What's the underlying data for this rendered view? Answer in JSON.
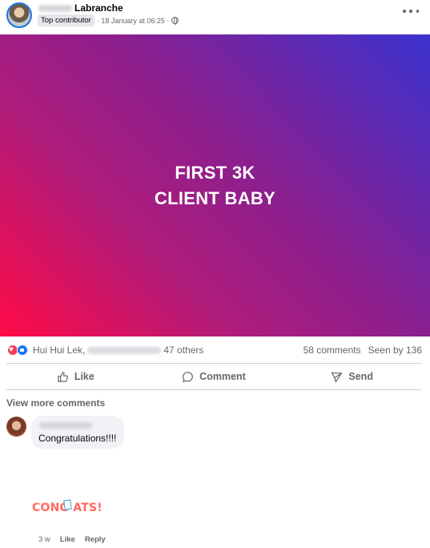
{
  "post": {
    "author_last_name": "Labranche",
    "badge": "Top contributor",
    "timestamp": "· 18 January at 06:25 ·",
    "banner_lines": [
      "FIRST 3K",
      "CLIENT BABY"
    ],
    "reactions": {
      "first_name": "Hui Hui Lek,",
      "others": "47 others",
      "comments": "58 comments",
      "seen_by": "Seen by 136"
    },
    "actions": {
      "like": "Like",
      "comment": "Comment",
      "send": "Send"
    }
  },
  "comments": {
    "view_more": "View more comments",
    "items": [
      {
        "text": "Congratulations!!!!"
      }
    ],
    "sticker_text": "CONG ATS!",
    "footer": {
      "age": "3 w",
      "like": "Like",
      "reply": "Reply"
    }
  },
  "colors": {
    "brand_blue": "#1877f2",
    "love_red": "#f33e58",
    "muted_text": "#65676b"
  }
}
